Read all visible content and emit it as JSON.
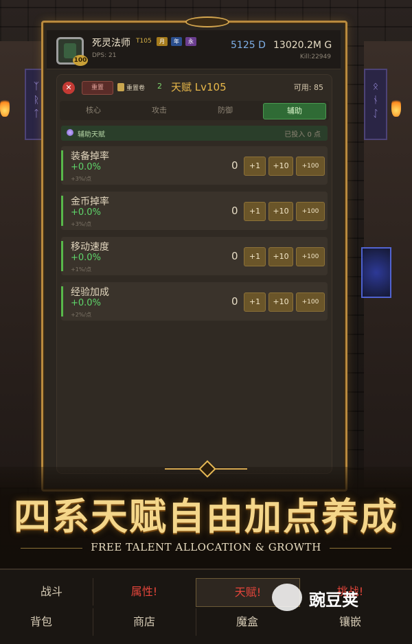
{
  "header": {
    "char_name": "死灵法师",
    "tier": "T105",
    "chips": [
      "月",
      "年",
      "永"
    ],
    "level_badge": "100",
    "dps": "DPS: 21",
    "currency_d": "5125 D",
    "currency_g": "13020.2M G",
    "kill": "Kill:22949"
  },
  "panel": {
    "reset_label": "重置",
    "scroll_label": "重置卷",
    "scroll_count": "2",
    "title": "天赋 Lv105",
    "available": "可用: 85",
    "tabs": [
      "核心",
      "攻击",
      "防御",
      "辅助"
    ],
    "active_tab": "辅助",
    "section_title": "辅助天赋",
    "section_invested": "已投入 0 点",
    "rows": [
      {
        "name": "装备掉率",
        "pct": "+0.0%",
        "per": "+3%/点",
        "count": "0"
      },
      {
        "name": "金币掉率",
        "pct": "+0.0%",
        "per": "+3%/点",
        "count": "0"
      },
      {
        "name": "移动速度",
        "pct": "+0.0%",
        "per": "+1%/点",
        "count": "0"
      },
      {
        "name": "经验加成",
        "pct": "+0.0%",
        "per": "+2%/点",
        "count": "0"
      }
    ],
    "btn_1": "+1",
    "btn_10": "+10",
    "btn_100": "+100"
  },
  "promo": {
    "title": "四系天赋自由加点养成",
    "subtitle": "FREE TALENT ALLOCATION & GROWTH"
  },
  "nav": {
    "row1": [
      "战斗",
      "属性!",
      "天赋!",
      "挑战!"
    ],
    "row2": [
      "背包",
      "商店",
      "魔盒",
      "镶嵌"
    ]
  },
  "watermark": "豌豆荚",
  "colors": {
    "accent_gold": "#e8b84a",
    "active_green": "#2f6b35",
    "alert_red": "#e4453b",
    "plus_green": "#5fd66b"
  }
}
